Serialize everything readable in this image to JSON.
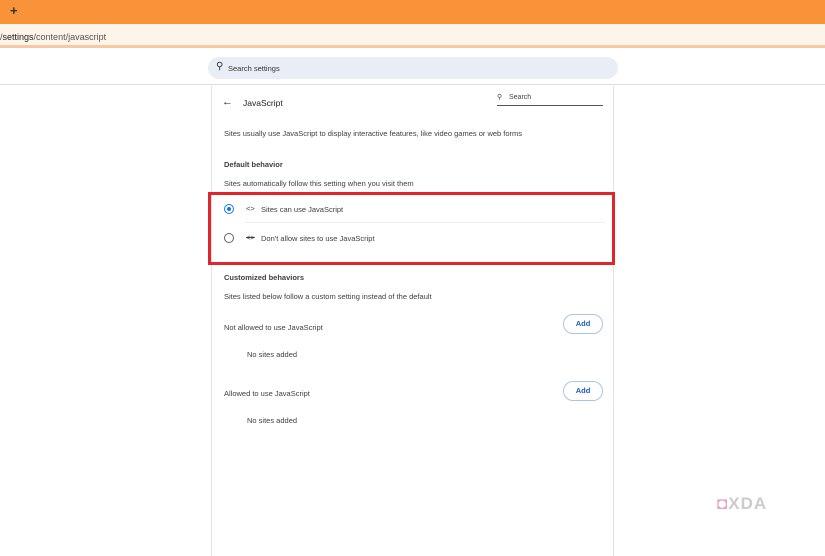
{
  "browser": {
    "new_tab_label": "+",
    "url_prefix": "/",
    "url_bold": "settings",
    "url_rest": "/content/javascript"
  },
  "search": {
    "placeholder": "Search settings"
  },
  "page": {
    "title": "JavaScript",
    "search_label": "Search",
    "description": "Sites usually use JavaScript to display interactive features, like video games or web forms",
    "default_heading": "Default behavior",
    "default_sub": "Sites automatically follow this setting when you visit them",
    "options": [
      {
        "label": "Sites can use JavaScript",
        "selected": true
      },
      {
        "label": "Don't allow sites to use JavaScript",
        "selected": false
      }
    ],
    "custom_heading": "Customized behaviors",
    "custom_sub": "Sites listed below follow a custom setting instead of the default",
    "not_allowed_label": "Not allowed to use JavaScript",
    "allowed_label": "Allowed to use JavaScript",
    "add_label": "Add",
    "no_sites": "No sites added"
  },
  "watermark": "XDA",
  "colors": {
    "highlight": "#e0262b",
    "accent": "#1a73e8",
    "tabbar": "#f99339"
  }
}
